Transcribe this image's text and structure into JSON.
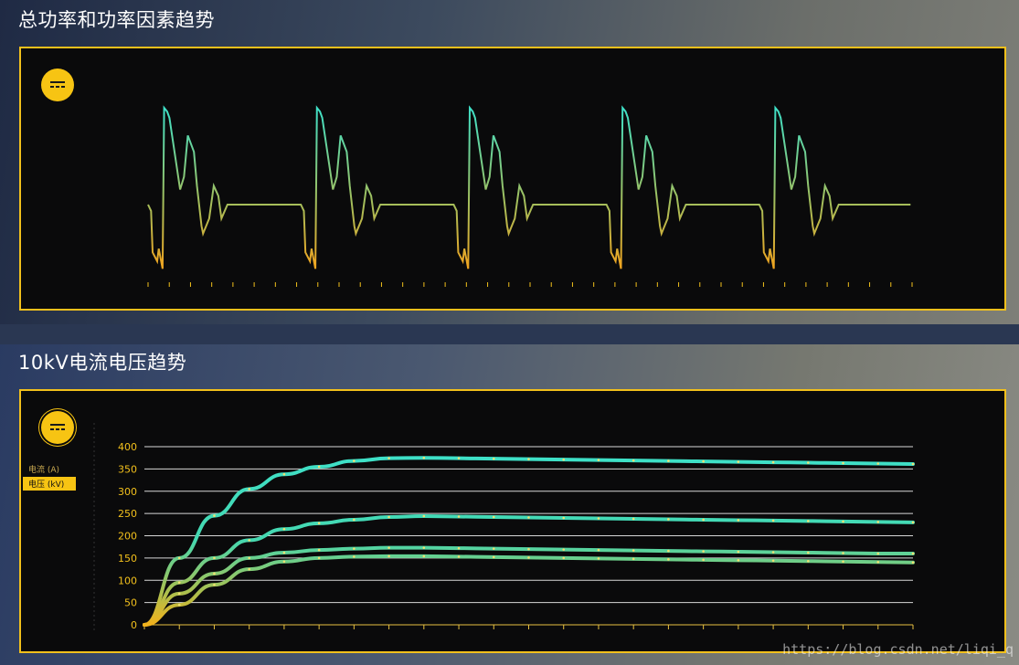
{
  "page": {
    "section1_title": "总功率和功率因素趋势",
    "section2_title": "10kV电流电压趋势",
    "watermark": "https://blog.csdn.net/liqi_q",
    "accent_color": "#f2c01c",
    "line_color_top": "#3ee0c8",
    "line_color_bottom": "#f5a31c"
  },
  "chart_data": [
    {
      "type": "line",
      "title": "总功率和功率因素趋势",
      "xlabel": "",
      "ylabel": "",
      "grid": false,
      "y_axis_visible": false,
      "cycles": 5,
      "cycle_profile_y": [
        0.23,
        0.18,
        -0.15,
        -0.22,
        -0.12,
        -0.28,
        1.0,
        0.97,
        0.92,
        0.35,
        0.45,
        0.78,
        0.65,
        0.38,
        0.06,
        0.0,
        0.12,
        0.38,
        0.3,
        0.12,
        0.23,
        0.23
      ]
    },
    {
      "type": "line",
      "title": "10kV电流电压趋势",
      "xlabel": "",
      "ylabel": "",
      "ylim": [
        0,
        400
      ],
      "yticks": [
        "0",
        "50",
        "100",
        "150",
        "200",
        "250",
        "300",
        "350",
        "400"
      ],
      "grid": true,
      "legend": [
        "电流 (A)",
        "电压 (kV)"
      ],
      "legend_active_index": 1,
      "x_count": 23,
      "series": [
        {
          "values": [
            0,
            150,
            245,
            305,
            338,
            355,
            368,
            374,
            375,
            374,
            373,
            372,
            371,
            370,
            369,
            368,
            367,
            366,
            365,
            364,
            363,
            362,
            361
          ]
        },
        {
          "values": [
            0,
            95,
            150,
            190,
            215,
            228,
            236,
            242,
            244,
            243,
            242,
            241,
            240,
            239,
            238,
            237,
            236,
            235,
            234,
            233,
            232,
            231,
            230
          ]
        },
        {
          "values": [
            0,
            70,
            115,
            150,
            162,
            168,
            171,
            173,
            173,
            172,
            171,
            170,
            169,
            168,
            167,
            166,
            165,
            164,
            163,
            162,
            161,
            160,
            160
          ]
        },
        {
          "values": [
            0,
            45,
            90,
            125,
            142,
            150,
            153,
            154,
            154,
            153,
            152,
            151,
            150,
            149,
            148,
            147,
            146,
            145,
            144,
            143,
            142,
            141,
            140
          ]
        }
      ]
    }
  ]
}
